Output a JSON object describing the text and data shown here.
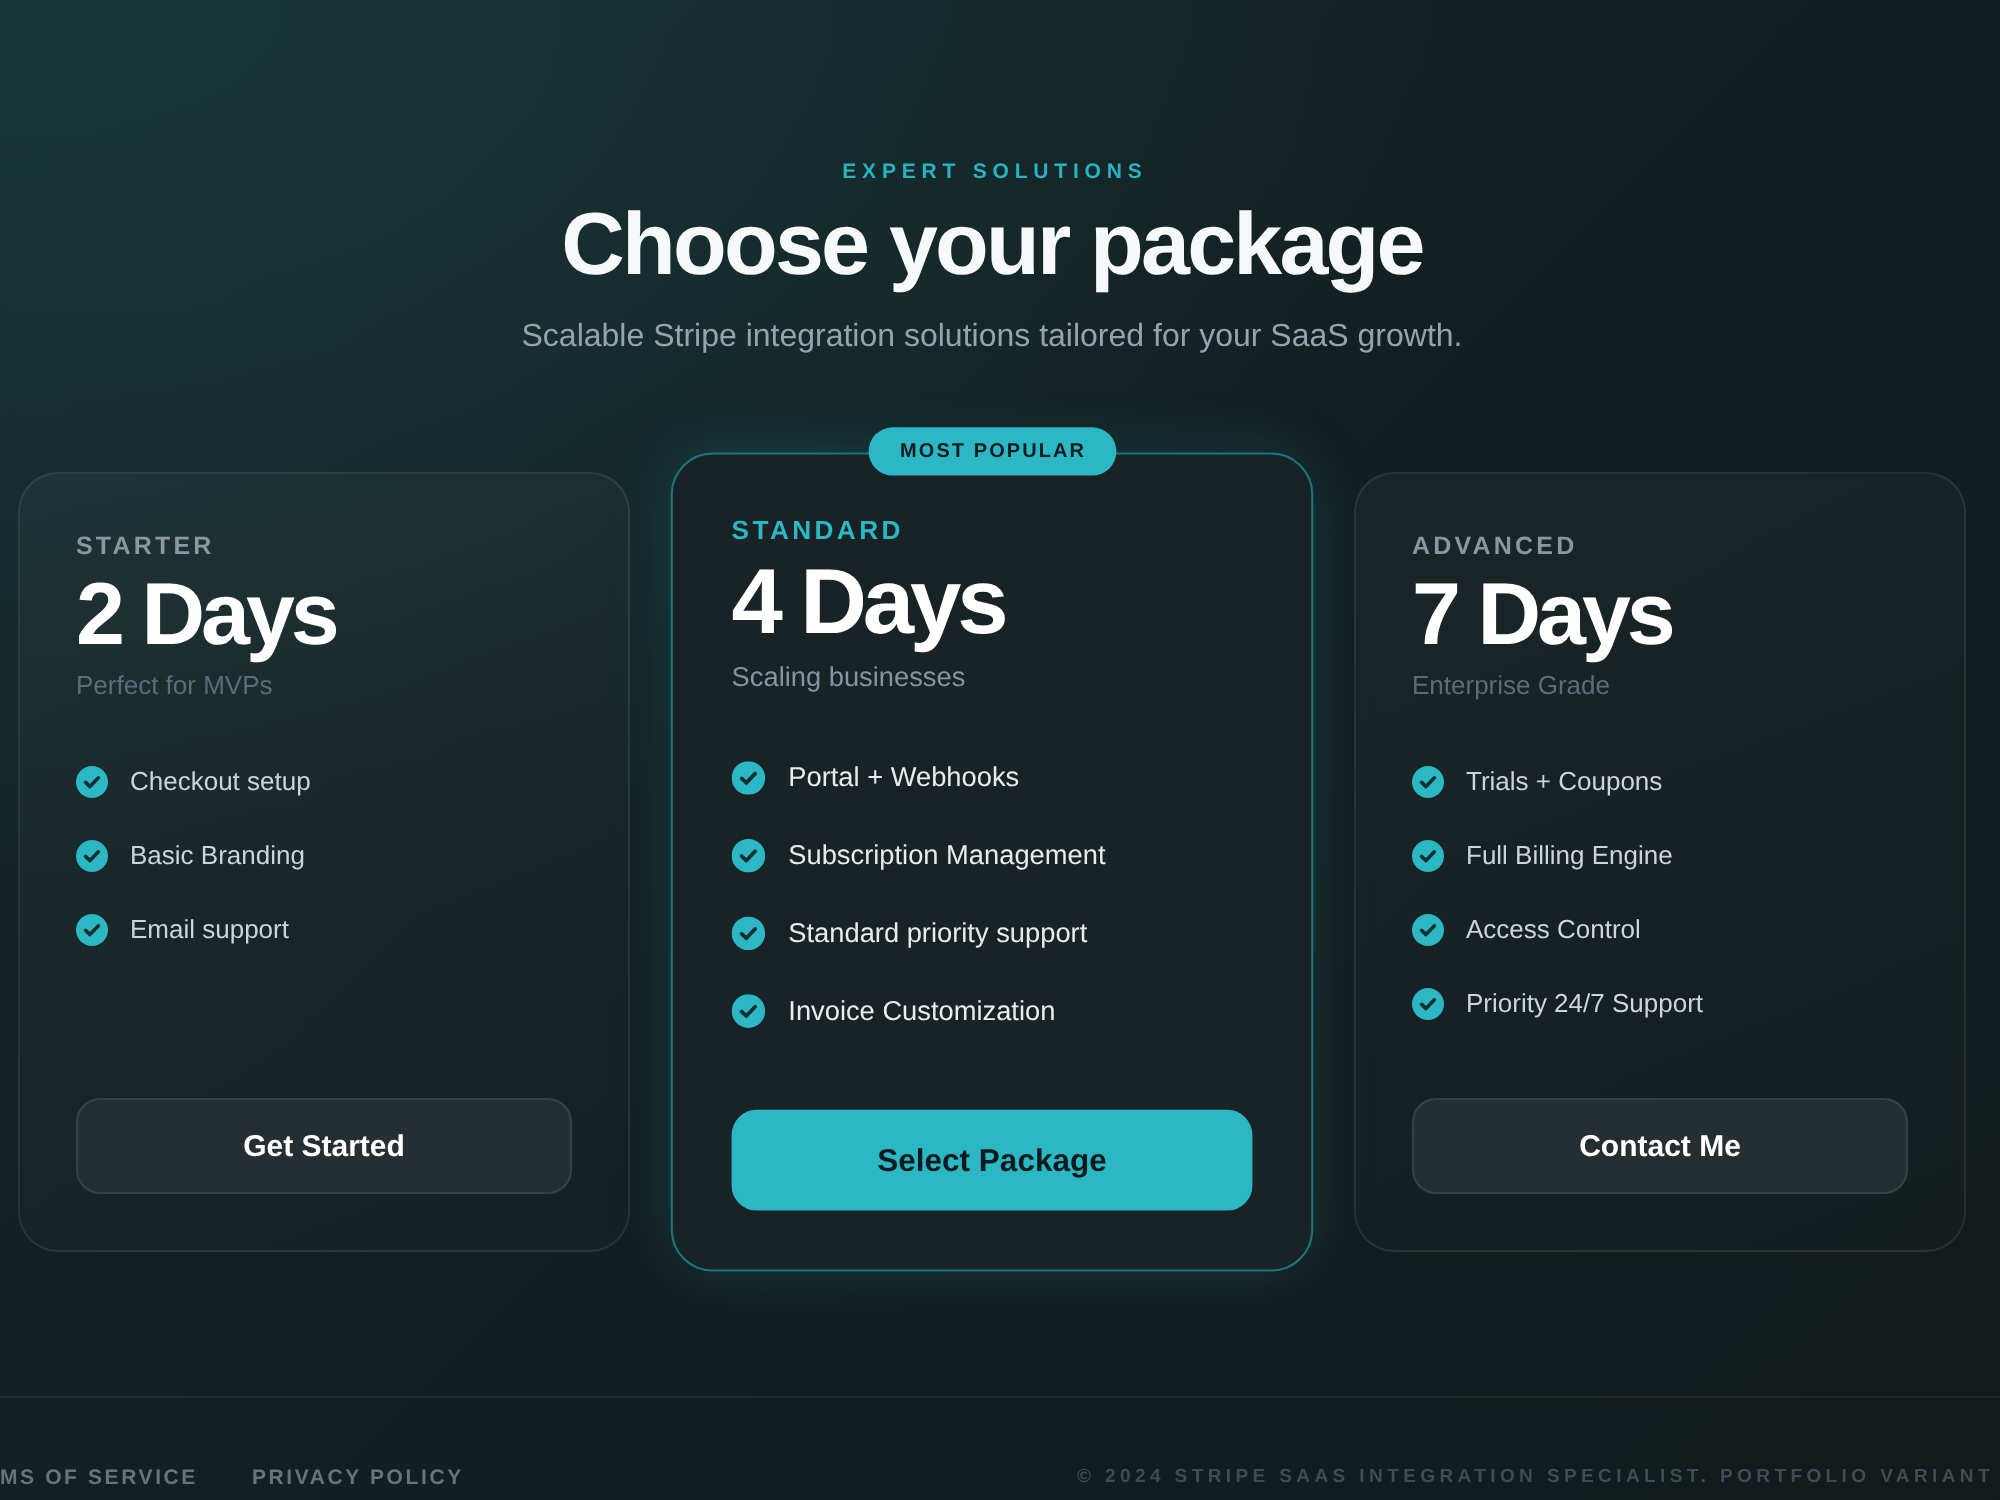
{
  "header": {
    "eyebrow": "EXPERT SOLUTIONS",
    "title": "Choose your package",
    "subtitle": "Scalable Stripe integration solutions tailored for your SaaS growth."
  },
  "plans": [
    {
      "name": "STARTER",
      "duration": "2 Days",
      "tagline": "Perfect for MVPs",
      "featured": false,
      "features": [
        "Checkout setup",
        "Basic Branding",
        "Email support"
      ],
      "button": "Get Started"
    },
    {
      "name": "STANDARD",
      "badge": "MOST POPULAR",
      "duration": "4 Days",
      "tagline": "Scaling businesses",
      "featured": true,
      "features": [
        "Portal + Webhooks",
        "Subscription Management",
        "Standard priority support",
        "Invoice Customization"
      ],
      "button": "Select Package"
    },
    {
      "name": "ADVANCED",
      "duration": "7 Days",
      "tagline": "Enterprise Grade",
      "featured": false,
      "features": [
        "Trials + Coupons",
        "Full Billing Engine",
        "Access Control",
        "Priority 24/7 Support"
      ],
      "button": "Contact Me"
    }
  ],
  "footer": {
    "links": [
      "MS OF SERVICE",
      "PRIVACY POLICY"
    ],
    "copyright": "© 2024 STRIPE SAAS INTEGRATION SPECIALIST. PORTFOLIO VARIANT"
  }
}
